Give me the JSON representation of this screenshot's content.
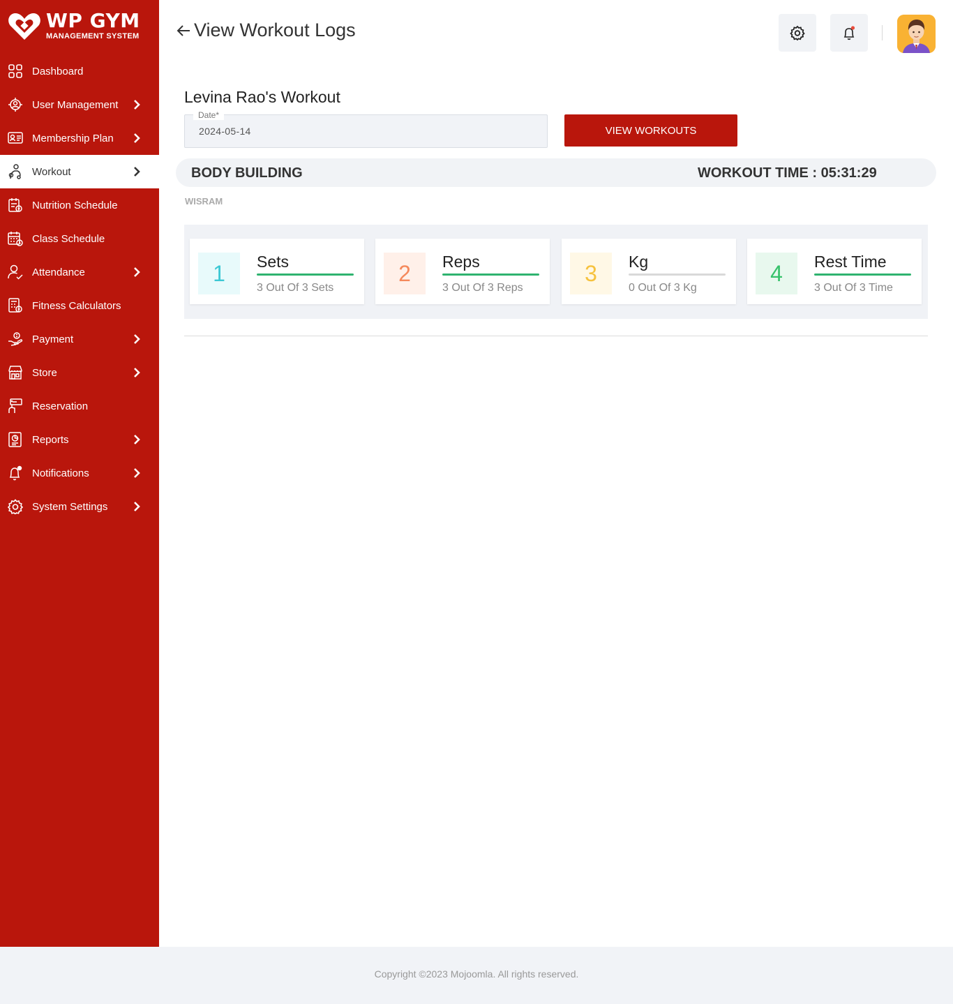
{
  "brand": {
    "title": "WP GYM",
    "subtitle": "MANAGEMENT SYSTEM"
  },
  "sidebar": {
    "items": [
      {
        "label": "Dashboard",
        "icon": "dashboard-icon",
        "has_children": false,
        "active": false
      },
      {
        "label": "User Management",
        "icon": "users-gear-icon",
        "has_children": true,
        "active": false
      },
      {
        "label": "Membership Plan",
        "icon": "membership-card-icon",
        "has_children": true,
        "active": false
      },
      {
        "label": "Workout",
        "icon": "workout-icon",
        "has_children": true,
        "active": true
      },
      {
        "label": "Nutrition Schedule",
        "icon": "nutrition-icon",
        "has_children": false,
        "active": false
      },
      {
        "label": "Class Schedule",
        "icon": "calendar-icon",
        "has_children": false,
        "active": false
      },
      {
        "label": "Attendance",
        "icon": "attendance-icon",
        "has_children": true,
        "active": false
      },
      {
        "label": "Fitness Calculators",
        "icon": "calculator-icon",
        "has_children": false,
        "active": false
      },
      {
        "label": "Payment",
        "icon": "payment-icon",
        "has_children": true,
        "active": false
      },
      {
        "label": "Store",
        "icon": "store-icon",
        "has_children": true,
        "active": false
      },
      {
        "label": "Reservation",
        "icon": "reservation-icon",
        "has_children": false,
        "active": false
      },
      {
        "label": "Reports",
        "icon": "reports-icon",
        "has_children": true,
        "active": false
      },
      {
        "label": "Notifications",
        "icon": "bell-icon",
        "has_children": true,
        "active": false
      },
      {
        "label": "System Settings",
        "icon": "gear-icon",
        "has_children": true,
        "active": false
      }
    ]
  },
  "header": {
    "title": "View Workout Logs"
  },
  "main": {
    "member_title": "Levina Rao's Workout",
    "date_field": {
      "label": "Date*",
      "value": "2024-05-14"
    },
    "view_button": "VIEW WORKOUTS",
    "workout": {
      "name": "BODY BUILDING",
      "time": "WORKOUT TIME : 05:31:29"
    },
    "activity": "WISRAM",
    "cards": [
      {
        "number": "1",
        "title": "Sets",
        "sub": "3 Out Of 3 Sets",
        "num_color": "#3cc8d4",
        "num_bg": "#e8fafb",
        "line_color": "#2fb36f"
      },
      {
        "number": "2",
        "title": "Reps",
        "sub": "3 Out Of 3 Reps",
        "num_color": "#f5895c",
        "num_bg": "#fff0e9",
        "line_color": "#2fb36f"
      },
      {
        "number": "3",
        "title": "Kg",
        "sub": "0 Out Of 3 Kg",
        "num_color": "#f6c23e",
        "num_bg": "#fff8e6",
        "line_color": "#d9d9d9"
      },
      {
        "number": "4",
        "title": "Rest Time",
        "sub": "3 Out Of 3 Time",
        "num_color": "#37c26b",
        "num_bg": "#e8f8ee",
        "line_color": "#2fb36f"
      }
    ]
  },
  "footer": {
    "copyright": "Copyright ©2023 Mojoomla. All rights reserved."
  },
  "colors": {
    "brand": "#b9160c",
    "background": "#ffffff",
    "panel": "#f1f3f6"
  }
}
